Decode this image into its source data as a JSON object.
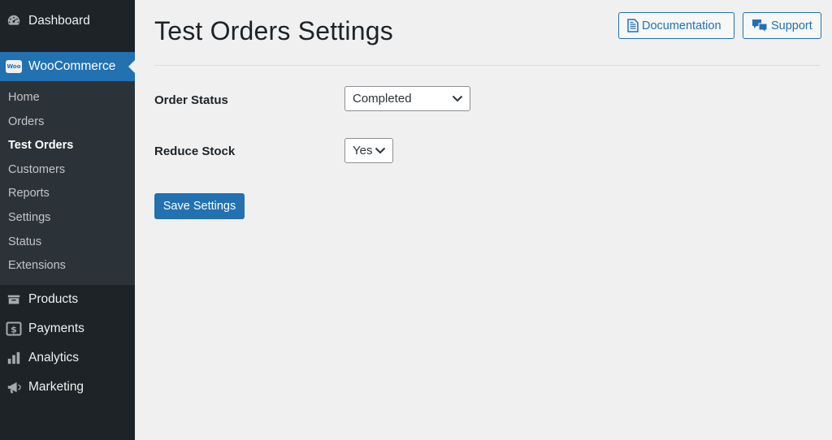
{
  "sidebar": {
    "dashboard": "Dashboard",
    "woocommerce": "WooCommerce",
    "woo_badge": "Woo",
    "submenu": [
      "Home",
      "Orders",
      "Test Orders",
      "Customers",
      "Reports",
      "Settings",
      "Status",
      "Extensions"
    ],
    "current_submenu": "Test Orders",
    "lower": [
      "Products",
      "Payments",
      "Analytics",
      "Marketing"
    ],
    "icons": [
      "dashboard-icon",
      "woocommerce-icon",
      "products-icon",
      "payments-icon",
      "analytics-icon",
      "marketing-icon"
    ]
  },
  "header": {
    "title": "Test Orders Settings",
    "documentation_label": "Documentation",
    "support_label": "Support"
  },
  "form": {
    "order_status_label": "Order Status",
    "order_status_value": "Completed",
    "reduce_stock_label": "Reduce Stock",
    "reduce_stock_value": "Yes",
    "save_label": "Save Settings"
  },
  "colors": {
    "sidebar_bg": "#1d2327",
    "submenu_bg": "#2c3338",
    "accent": "#2271b1",
    "page_bg": "#f0f0f1"
  }
}
